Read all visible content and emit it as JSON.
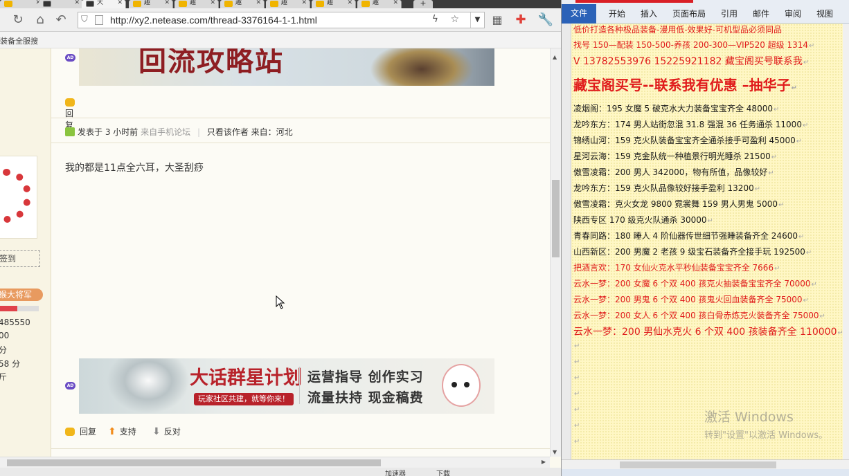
{
  "browser": {
    "tabs": [
      {
        "label": "",
        "close": "✕",
        "type": "doc"
      },
      {
        "label": "",
        "close": "✕",
        "type": "dark"
      },
      {
        "label": "大",
        "close": "✕",
        "type": "dark"
      },
      {
        "label": "趣",
        "close": "✕",
        "type": "fav"
      },
      {
        "label": "趣",
        "close": "✕",
        "type": "fav"
      },
      {
        "label": "趣",
        "close": "✕",
        "type": "fav"
      },
      {
        "label": "趣",
        "close": "✕",
        "type": "fav"
      },
      {
        "label": "趣",
        "close": "✕",
        "type": "fav"
      },
      {
        "label": "趣",
        "close": "✕",
        "type": "fav"
      }
    ],
    "new_tab": "+",
    "url": "http://xy2.netease.com/thread-3376164-1-1.html",
    "bookmark": "装备全服搜"
  },
  "sidebar": {
    "signin": "签到",
    "rank": "猴大将军",
    "rank_progress": 0.48,
    "stats": [
      "485550",
      "00",
      "分",
      "58 分",
      "斤"
    ]
  },
  "thread": {
    "reply1": "回复",
    "meta": {
      "posted": "发表于 3 小时前",
      "source": "来自手机论坛",
      "only_author": "只看该作者",
      "from": "来自：河北"
    },
    "post_text": "我的都是11点全六耳，大圣刮痧",
    "ad_badge": "AD",
    "banner_top_title": "回流攻略站",
    "banner_bottom": {
      "title": "大话群星计划",
      "tagline": "玩家社区共建，就等你来！",
      "slogan1": "运营指导  创作实习",
      "slogan2": "流量扶持  现金稿费"
    },
    "reply2": "回复",
    "support": "支持",
    "oppose": "反对"
  },
  "browser_status": {
    "left": "加速器",
    "download": "下载"
  },
  "word": {
    "ribbon_tabs": [
      "文件",
      "开始",
      "插入",
      "页面布局",
      "引用",
      "邮件",
      "审阅",
      "视图"
    ],
    "lines": [
      "低价打造各种极品装备-漫用低-效果好-可机型品必须同品",
      "找号 150—配装 150-500-养孩 200-300—VIP520 超级 1314",
      "V 13782553976    15225921182  藏宝阁买号联系我",
      "藏宝阁买号--联系我有优惠 –抽华子",
      "凌烟阁：195 女魔 5 破克水大力装备宝宝齐全 48000",
      "龙吟东方：174 男人站街忽混 31.8 强混 36 任务通杀 11000",
      "锦绣山河：159 克火队装备宝宝齐全通杀接手可盈利 45000",
      "星河云海：159 克金队统一种植景行明光睡杀 21500",
      "傲雪凌霜：200 男人 342000，物有所值，品像较好",
      "龙吟东方：159 克火队品像较好接手盈利 13200",
      "傲雪凌霜：克火女龙 9800      霓裳舞 159 男人男鬼 5000",
      "陕西专区 170 级克火队通杀 30000",
      "青春同路：180 睡人 4 阶仙器传世细节强睡装备齐全 24600",
      "山西新区：200 男魔 2 老孩 9 级宝石装备齐全接手玩 192500",
      "把酒言欢：170 女仙火克水平秒仙装备宝宝齐全 7666",
      "云水一梦：200 女魔 6 个双 400 孩克火抽装备宝宝齐全 70000",
      "云水一梦：200 男鬼 6 个双 400 孩鬼火回血装备齐全 75000",
      "云水一梦：200 女人 6 个双 400 孩白骨赤炼克火装备齐全 75000",
      "云水一梦：200 男仙水克火 6 个双 400 孩装备齐全 110000"
    ],
    "paragraph_mark": "↵",
    "watermark1": "激活 Windows",
    "watermark2": "转到\"设置\"以激活 Windows。"
  }
}
